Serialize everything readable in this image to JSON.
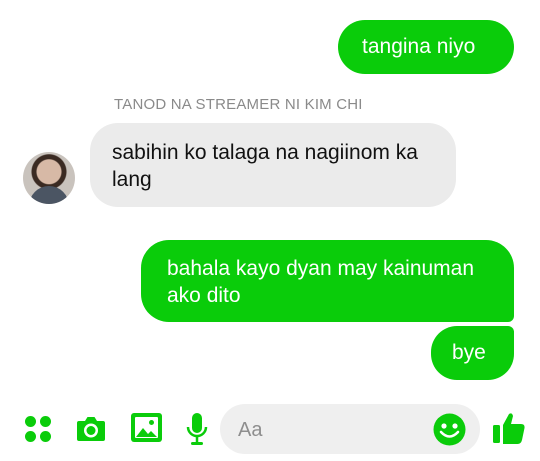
{
  "messages": [
    {
      "direction": "outgoing",
      "text": "tangina niyo"
    },
    {
      "direction": "incoming",
      "sender": "TANOD NA STREAMER NI KIM CHI",
      "text": "sabihin ko talaga na nagiinom ka lang"
    },
    {
      "direction": "outgoing",
      "text": "bahala kayo dyan may kainuman ako dito"
    },
    {
      "direction": "outgoing",
      "text": "bye"
    }
  ],
  "composer": {
    "placeholder": "Aa",
    "icons": [
      "apps-icon",
      "camera-icon",
      "image-icon",
      "mic-icon",
      "emoji-icon",
      "like-icon"
    ]
  },
  "colors": {
    "accent": "#0acc0a",
    "incoming_bubble": "#ebebeb",
    "sender_label": "#8a8a8a"
  }
}
